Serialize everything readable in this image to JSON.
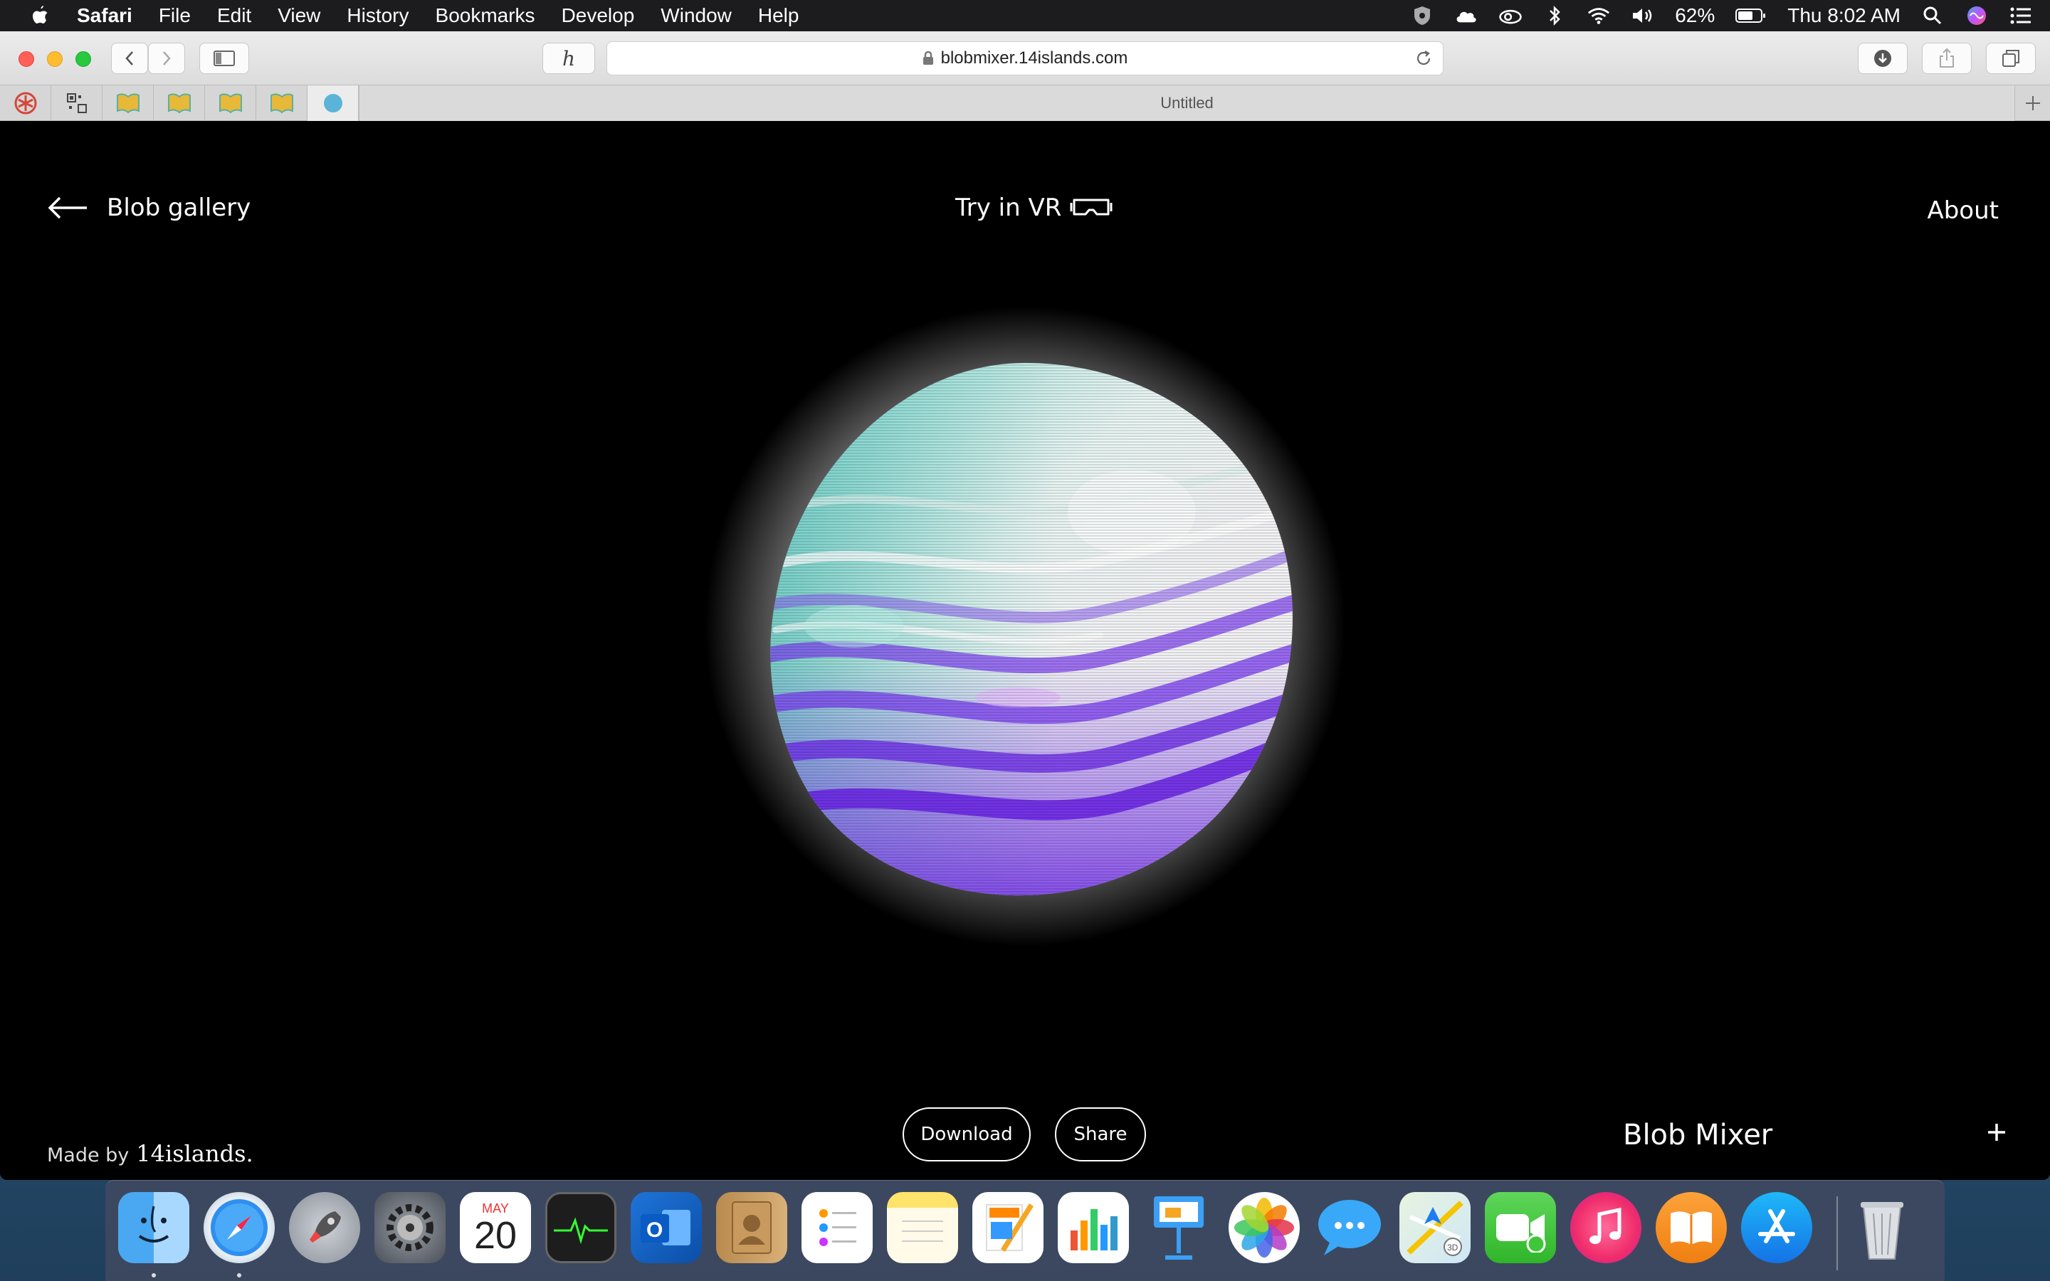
{
  "menubar": {
    "app_name": "Safari",
    "items": [
      "File",
      "Edit",
      "View",
      "History",
      "Bookmarks",
      "Develop",
      "Window",
      "Help"
    ],
    "battery": "62%",
    "clock": "Thu 8:02 AM"
  },
  "browser": {
    "url": "blobmixer.14islands.com",
    "tab_title": "Untitled",
    "pinned_tabs": [
      "asterisk-icon",
      "qr-icon",
      "book-icon",
      "book-icon",
      "book-icon",
      "book-icon",
      "blue-dot-icon"
    ]
  },
  "page": {
    "back_label": "Blob gallery",
    "vr_label": "Try in VR",
    "about_label": "About",
    "made_by_prefix": "Made by",
    "made_by_brand": "14islands.",
    "download_label": "Download",
    "share_label": "Share",
    "blob_name": "Blob Mixer"
  },
  "dock": {
    "apps": [
      "Finder",
      "Safari",
      "Launchpad",
      "System Preferences",
      "Calendar",
      "Activity Monitor",
      "Outlook",
      "Contacts",
      "Reminders",
      "Notes",
      "Pages",
      "Numbers",
      "Keynote",
      "Photos",
      "Messages",
      "Maps",
      "FaceTime",
      "iTunes",
      "Books",
      "App Store",
      "Trash"
    ],
    "calendar_month": "MAY",
    "calendar_day": "20"
  },
  "colors": {
    "page_bg": "#000000",
    "blob_teal": "#6fd3c9",
    "blob_purple": "#7a3cf0",
    "blob_white": "#f4f4f6"
  }
}
